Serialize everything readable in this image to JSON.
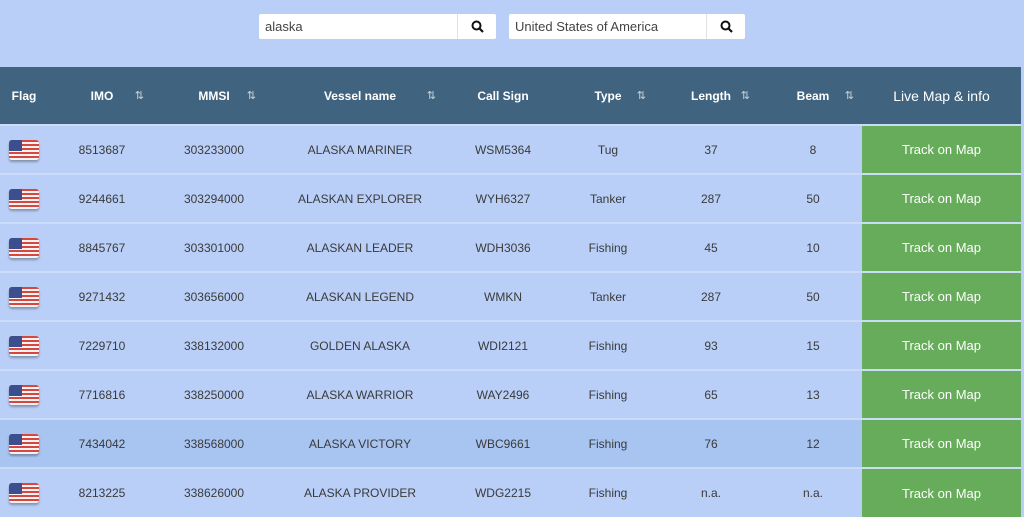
{
  "search": {
    "query": "alaska",
    "country": "United States of America",
    "icon": "search-icon"
  },
  "columns": {
    "flag": "Flag",
    "imo": "IMO",
    "mmsi": "MMSI",
    "name": "Vessel name",
    "call": "Call Sign",
    "type": "Type",
    "length": "Length",
    "beam": "Beam",
    "live": "Live Map & info",
    "sort_icon": "⇅"
  },
  "rows": [
    {
      "imo": "8513687",
      "mmsi": "303233000",
      "name": "ALASKA MARINER",
      "call": "WSM5364",
      "type": "Tug",
      "length": "37",
      "beam": "8",
      "action": "Track on Map"
    },
    {
      "imo": "9244661",
      "mmsi": "303294000",
      "name": "ALASKAN EXPLORER",
      "call": "WYH6327",
      "type": "Tanker",
      "length": "287",
      "beam": "50",
      "action": "Track on Map"
    },
    {
      "imo": "8845767",
      "mmsi": "303301000",
      "name": "ALASKAN LEADER",
      "call": "WDH3036",
      "type": "Fishing",
      "length": "45",
      "beam": "10",
      "action": "Track on Map"
    },
    {
      "imo": "9271432",
      "mmsi": "303656000",
      "name": "ALASKAN LEGEND",
      "call": "WMKN",
      "type": "Tanker",
      "length": "287",
      "beam": "50",
      "action": "Track on Map"
    },
    {
      "imo": "7229710",
      "mmsi": "338132000",
      "name": "GOLDEN ALASKA",
      "call": "WDI2121",
      "type": "Fishing",
      "length": "93",
      "beam": "15",
      "action": "Track on Map"
    },
    {
      "imo": "7716816",
      "mmsi": "338250000",
      "name": "ALASKA WARRIOR",
      "call": "WAY2496",
      "type": "Fishing",
      "length": "65",
      "beam": "13",
      "action": "Track on Map"
    },
    {
      "imo": "7434042",
      "mmsi": "338568000",
      "name": "ALASKA VICTORY",
      "call": "WBC9661",
      "type": "Fishing",
      "length": "76",
      "beam": "12",
      "action": "Track on Map"
    },
    {
      "imo": "8213225",
      "mmsi": "338626000",
      "name": "ALASKA PROVIDER",
      "call": "WDG2215",
      "type": "Fishing",
      "length": "n.a.",
      "beam": "n.a.",
      "action": "Track on Map"
    }
  ]
}
